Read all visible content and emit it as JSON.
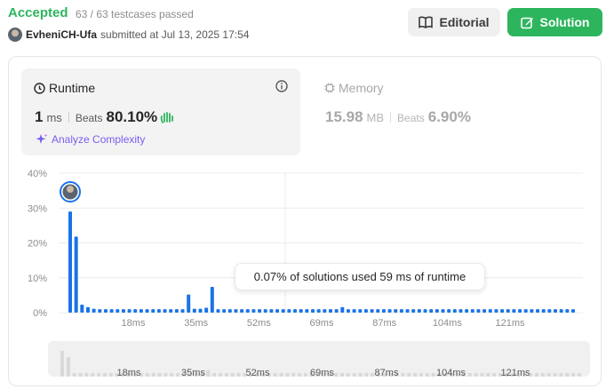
{
  "header": {
    "status": "Accepted",
    "testcases": "63 / 63 testcases passed",
    "username": "EvheniCH-Ufa",
    "submitted": "submitted at Jul 13, 2025 17:54",
    "editorial_label": "Editorial",
    "solution_label": "Solution"
  },
  "runtime": {
    "title": "Runtime",
    "value": "1",
    "unit": "ms",
    "beats_label": "Beats",
    "beats_value": "80.10%",
    "analyze_label": "Analyze Complexity"
  },
  "memory": {
    "title": "Memory",
    "value": "15.98",
    "unit": "MB",
    "beats_label": "Beats",
    "beats_value": "6.90%"
  },
  "tooltip": "0.07% of solutions used 59 ms of runtime",
  "colors": {
    "accent": "#2db55d",
    "bar": "#1a73e8",
    "purple": "#7a5cf0"
  },
  "chart_data": {
    "type": "bar",
    "xlabel": "",
    "ylabel": "",
    "ylim": [
      0,
      40
    ],
    "y_ticks": [
      "0%",
      "10%",
      "20%",
      "30%",
      "40%"
    ],
    "x_ticks": [
      "18ms",
      "35ms",
      "52ms",
      "69ms",
      "87ms",
      "104ms",
      "121ms"
    ],
    "series": [
      {
        "values": [
          29,
          21.8,
          2.3,
          1.6,
          1.1,
          1,
          1,
          1,
          1,
          1,
          1,
          1,
          1,
          1,
          1,
          1,
          1,
          1,
          1,
          1,
          5.2,
          1.1,
          1.1,
          1.4,
          7.4,
          1,
          1,
          1,
          1,
          1,
          1,
          1,
          1,
          1,
          1,
          1,
          1,
          1,
          1,
          1,
          1,
          1,
          1,
          1,
          1,
          1,
          1.6,
          1,
          1,
          1,
          1,
          1,
          1,
          1,
          1,
          1,
          1,
          1,
          1,
          1,
          1,
          1,
          1,
          1,
          1,
          1,
          1,
          1,
          1,
          1,
          1,
          1,
          1,
          1,
          1,
          1,
          1,
          1,
          1,
          1,
          1,
          1,
          1,
          1,
          1,
          1
        ]
      }
    ]
  }
}
